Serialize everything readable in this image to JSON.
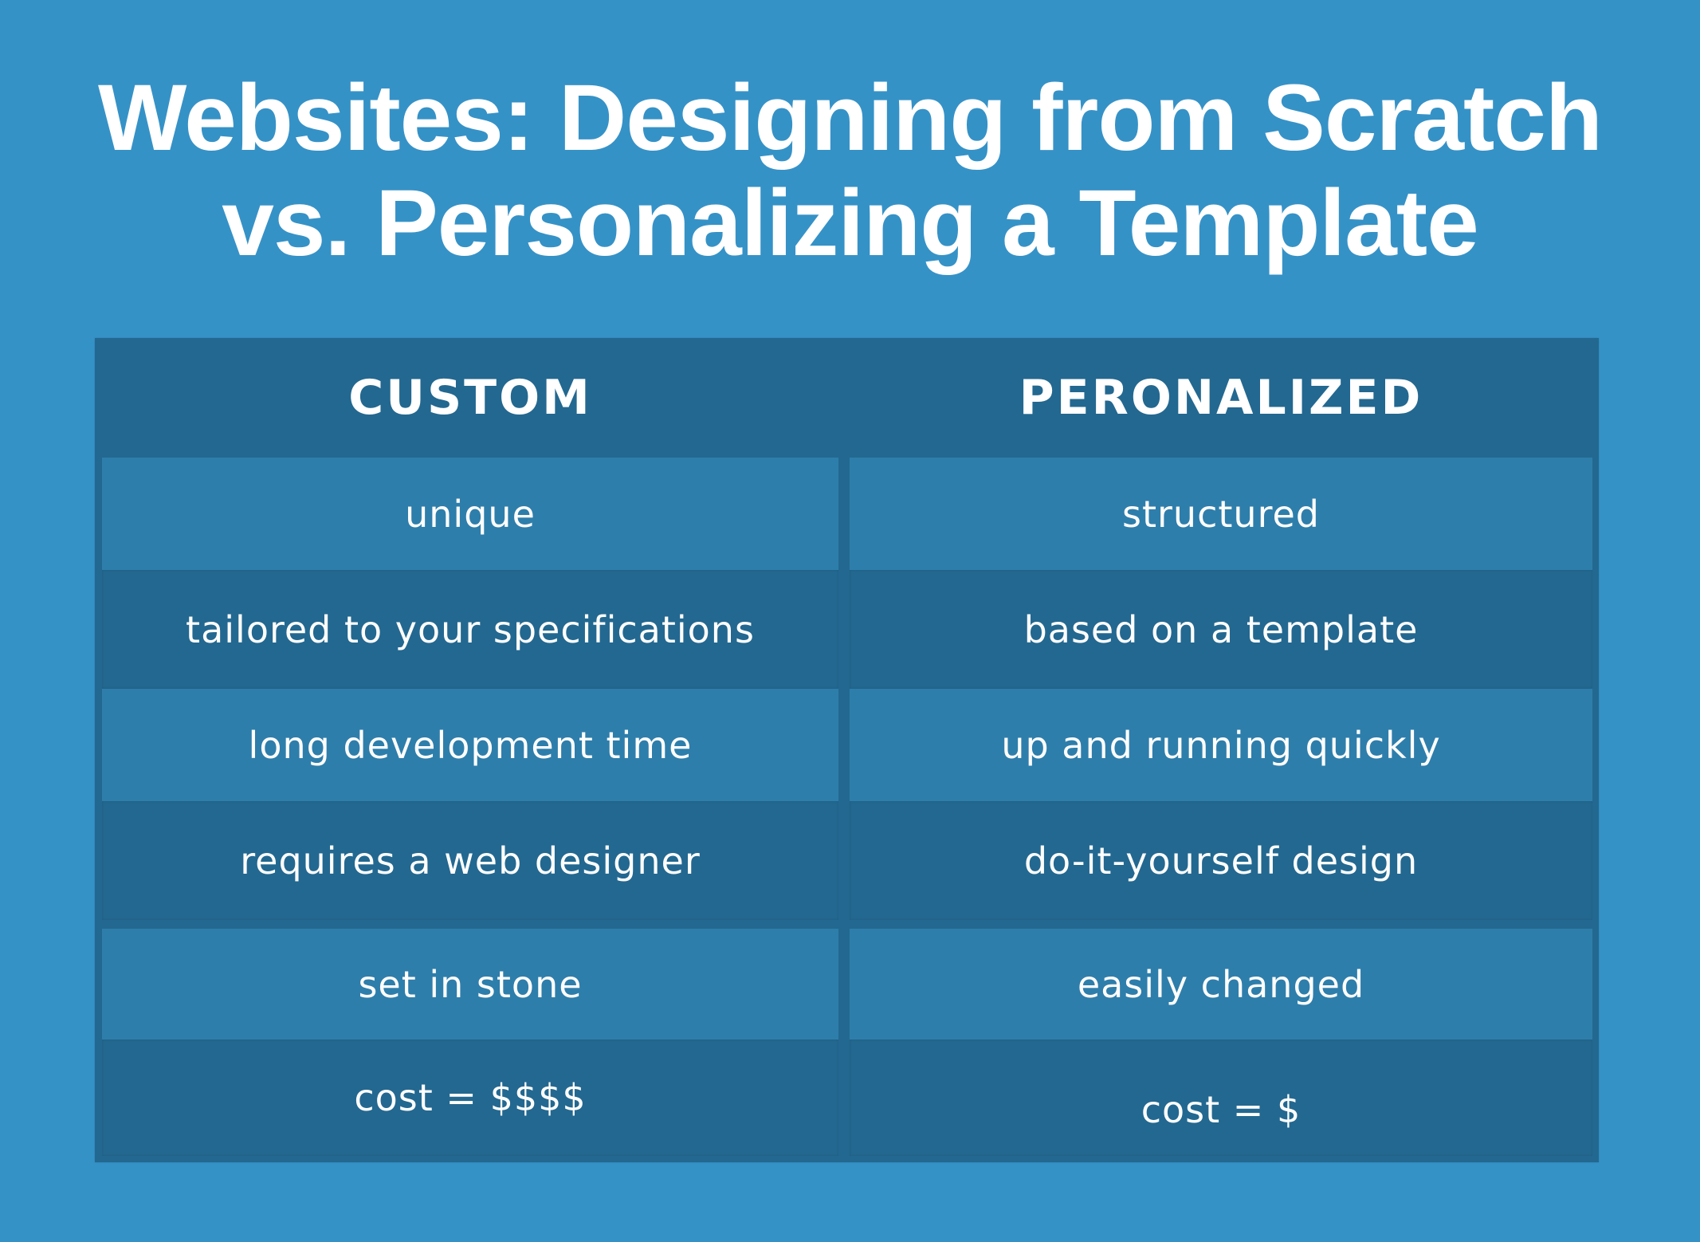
{
  "title": {
    "line1": "Websites: Designing from Scratch",
    "line2": "vs. Personalizing a Template"
  },
  "table": {
    "headers": [
      "CUSTOM",
      "PERONALIZED"
    ],
    "rows": [
      [
        "unique",
        "structured"
      ],
      [
        "tailored to your specifications",
        "based on a template"
      ],
      [
        "long development time",
        "up and running quickly"
      ],
      [
        "requires a web designer",
        "do-it-yourself design"
      ],
      [
        "set in stone",
        "easily changed"
      ],
      [
        "cost = $$$$",
        "cost = $"
      ]
    ]
  },
  "colors": {
    "background": "#3592c7",
    "table_dark": "#236890",
    "table_light": "#2e7eab",
    "text": "#ffffff"
  }
}
